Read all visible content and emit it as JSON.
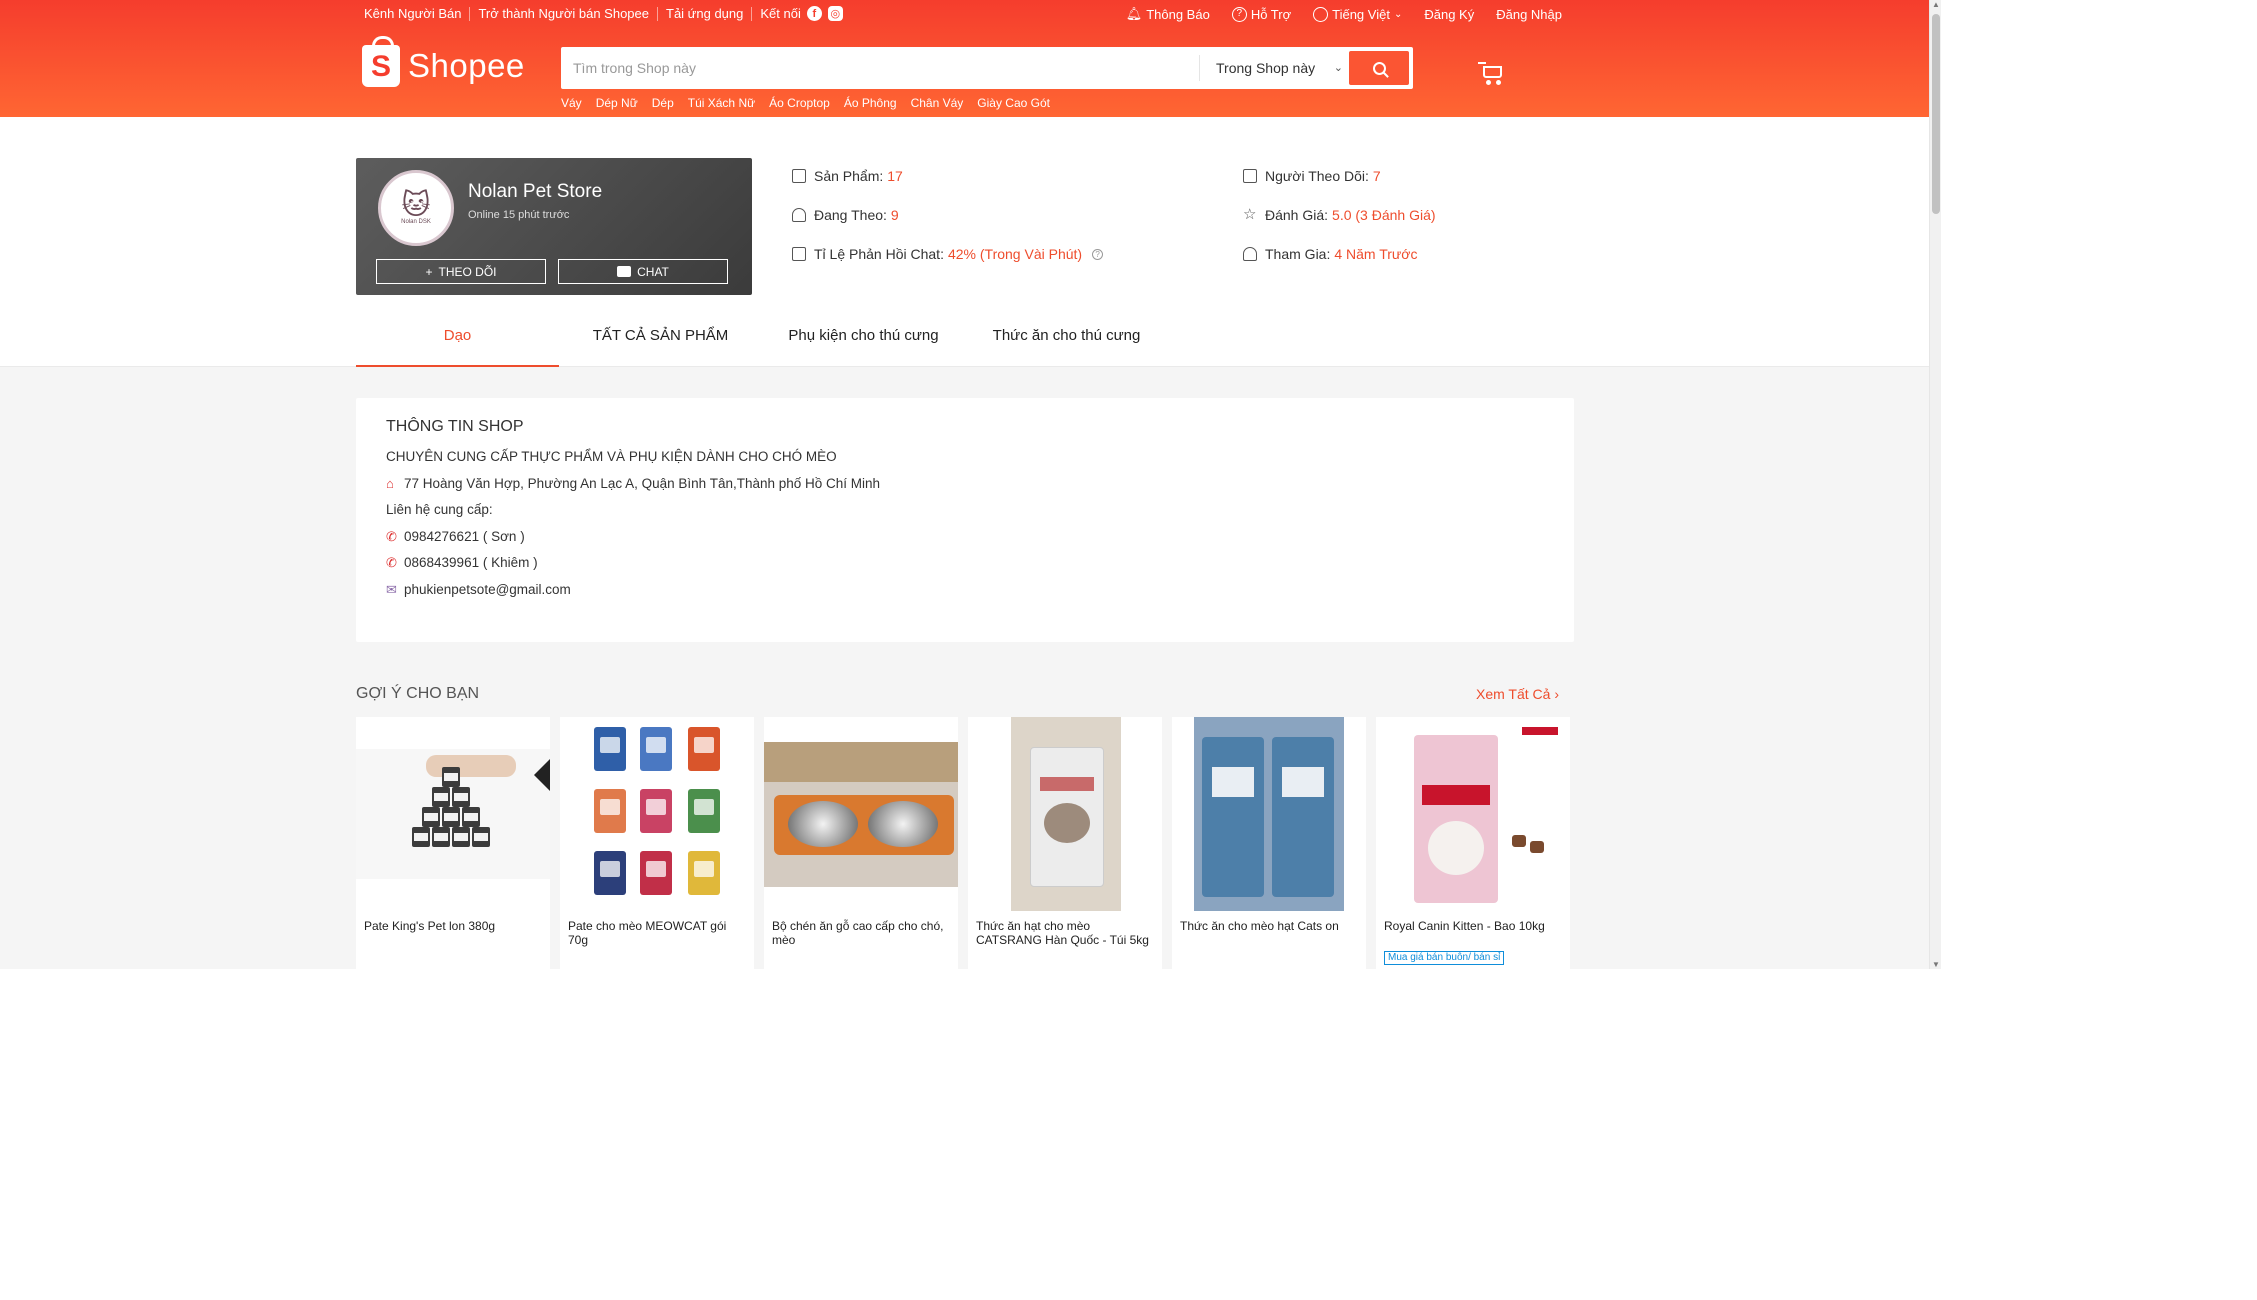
{
  "topbar": {
    "links": [
      "Kênh Người Bán",
      "Trở thành Người bán Shopee",
      "Tải ứng dụng"
    ],
    "connect_label": "Kết nối",
    "notifications": "Thông Báo",
    "help": "Hỗ Trợ",
    "language": "Tiếng Việt",
    "register": "Đăng Ký",
    "login": "Đăng Nhập"
  },
  "header": {
    "logo_text": "Shopee",
    "search_placeholder": "Tìm trong Shop này",
    "search_scope": "Trong Shop này",
    "hotwords": [
      "Váy",
      "Dép Nữ",
      "Dép",
      "Túi Xách Nữ",
      "Áo Croptop",
      "Áo Phông",
      "Chân Váy",
      "Giày Cao Gót"
    ]
  },
  "shop": {
    "name": "Nolan Pet Store",
    "online": "Online 15 phút trước",
    "avatar_text": "Nolan DSK",
    "follow_label": "THEO DÕI",
    "chat_label": "CHAT",
    "stats": {
      "products_label": "Sản Phẩm:",
      "products_value": "17",
      "following_label": "Đang Theo:",
      "following_value": "9",
      "response_label": "Tỉ Lệ Phản Hồi Chat:",
      "response_value": "42% (Trong Vài Phút)",
      "followers_label": "Người Theo Dõi:",
      "followers_value": "7",
      "rating_label": "Đánh Giá:",
      "rating_value": "5.0 (3 Đánh Giá)",
      "joined_label": "Tham Gia:",
      "joined_value": "4 Năm Trước"
    }
  },
  "tabs": [
    "Dạo",
    "TẤT CẢ SẢN PHẨM",
    "Phụ kiện cho thú cưng",
    "Thức ăn cho thú cưng"
  ],
  "shop_info": {
    "title": "THÔNG TIN SHOP",
    "tagline": "CHUYÊN CUNG CẤP THỰC PHẨM VÀ PHỤ KIỆN DÀNH CHO CHÓ MÈO",
    "address": "77 Hoàng Văn Hợp, Phường An Lạc A, Quận Bình Tân,Thành phố Hồ Chí Minh",
    "contact_label": "Liên hệ cung cấp:",
    "phone1": "0984276621 ( Sơn )",
    "phone2": "0868439961 ( Khiêm )",
    "email": "phukienpetsote@gmail.com"
  },
  "recommend": {
    "title": "GỢI Ý CHO BẠN",
    "see_all": "Xem Tất Cả",
    "products": [
      {
        "name": "Pate King's Pet lon 380g"
      },
      {
        "name": "Pate cho mèo MEOWCAT gói 70g"
      },
      {
        "name": "Bộ chén ăn gỗ cao cấp cho chó, mèo"
      },
      {
        "name": "Thức ăn hạt cho mèo CATSRANG Hàn Quốc - Túi 5kg"
      },
      {
        "name": "Thức ăn cho mèo hạt Cats on"
      },
      {
        "name": "Royal Canin Kitten - Bao 10kg",
        "tag": "Mua giá bán buôn/ bán sỉ"
      }
    ]
  },
  "colors": {
    "brand": "#ee4d2d",
    "header_top": "#f53d2d",
    "header_bottom": "#ff6633"
  }
}
